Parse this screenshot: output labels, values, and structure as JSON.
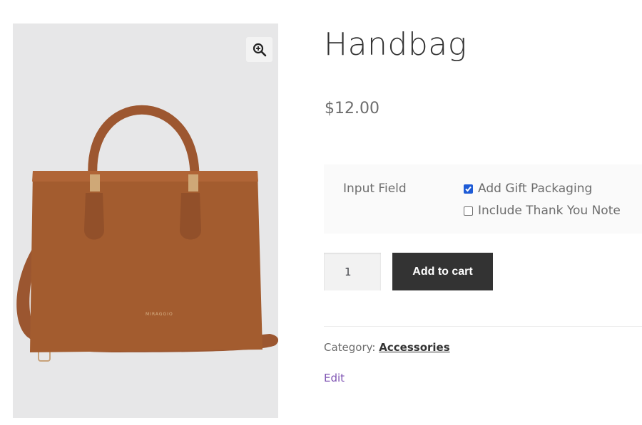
{
  "product": {
    "title": "Handbag",
    "price": "$12.00",
    "image_brand_text": "MIRAGGIO"
  },
  "addons": {
    "label": "Input Field",
    "options": [
      {
        "label": "Add Gift Packaging",
        "checked": true
      },
      {
        "label": "Include Thank You Note",
        "checked": false
      }
    ]
  },
  "cart": {
    "quantity": "1",
    "add_to_cart_label": "Add to cart"
  },
  "meta": {
    "category_label": "Category:",
    "category_value": "Accessories",
    "edit_label": "Edit"
  },
  "icons": {
    "zoom": "zoom-in-icon"
  },
  "colors": {
    "button_bg": "#333333",
    "link_purple": "#7f54b3",
    "checkbox_blue": "#1e5bd6",
    "bag_brown": "#a35c2f"
  }
}
